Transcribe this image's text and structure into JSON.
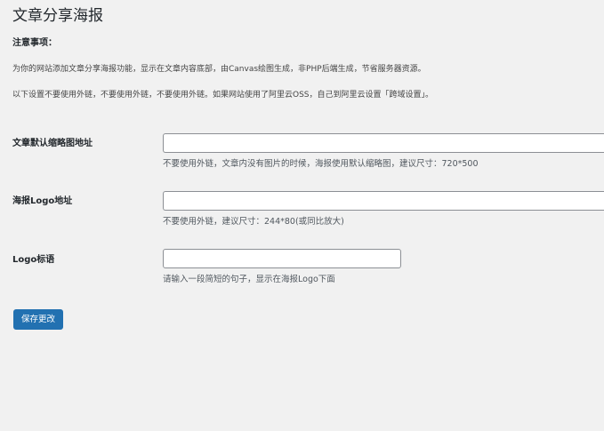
{
  "page": {
    "title": "文章分享海报"
  },
  "notice": {
    "heading": "注意事项：",
    "lines": [
      "为你的网站添加文章分享海报功能，显示在文章内容底部，由Canvas绘图生成，非PHP后端生成，节省服务器资源。",
      "以下设置不要使用外链，不要使用外链，不要使用外链。如果网站使用了阿里云OSS，自己到阿里云设置「跨域设置」。"
    ]
  },
  "fields": {
    "default_thumbnail": {
      "label": "文章默认缩略图地址",
      "value": "",
      "description": "不要使用外链，文章内没有图片的时候，海报使用默认缩略图，建议尺寸：720*500"
    },
    "poster_logo": {
      "label": "海报Logo地址",
      "value": "",
      "description": "不要使用外链，建议尺寸：244*80(或同比放大)"
    },
    "logo_slogan": {
      "label": "Logo标语",
      "value": "",
      "description": "请输入一段简短的句子，显示在海报Logo下面"
    }
  },
  "actions": {
    "save_label": "保存更改"
  },
  "colors": {
    "background": "#f1f1f1",
    "primary_button": "#2271b1"
  }
}
